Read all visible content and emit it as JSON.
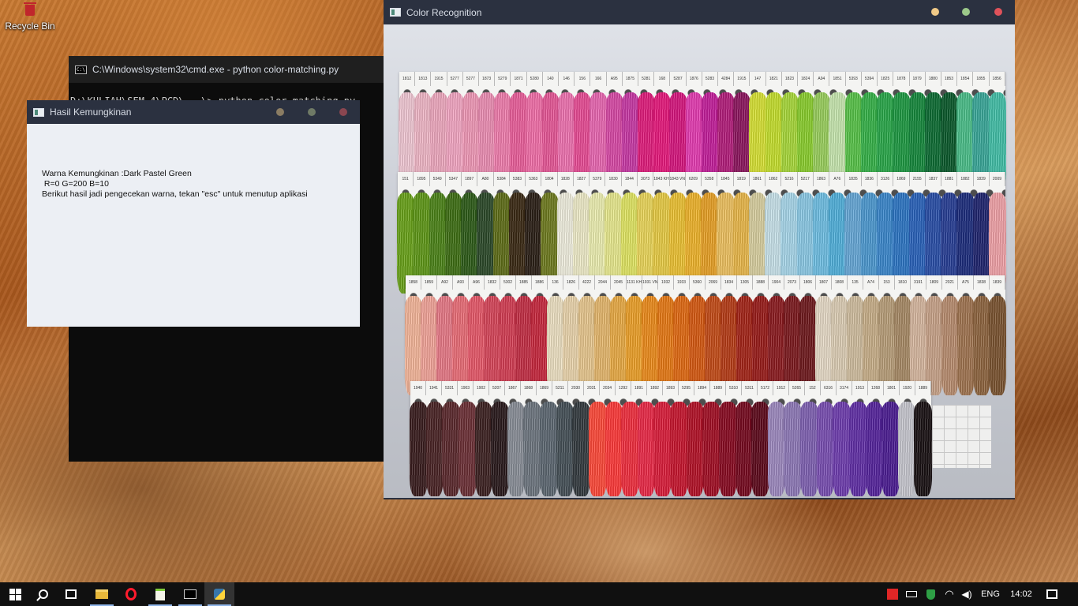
{
  "desktop": {
    "recycle_bin_label": "Recycle Bin"
  },
  "cmd_window": {
    "title": "C:\\Windows\\system32\\cmd.exe - python  color-matching.py",
    "console_line": "D:\\KULIAH\\SEM 4\\PCD\\...\\> python color-matching.py"
  },
  "hasil_window": {
    "title": "Hasil Kemungkinan",
    "line1": "Warna Kemungkinan :Dark Pastel Green",
    "line2": " R=0 G=200 B=10",
    "line3": "Berikut hasil jadi pengecekan warna, tekan \"esc\" untuk menutup aplikasi",
    "dot_colors": [
      "#8a7c63",
      "#6f7a66",
      "#8a4650"
    ]
  },
  "color_window": {
    "title": "Color Recognition",
    "dot_colors": [
      "#f0c987",
      "#9cc98a",
      "#e0525a"
    ],
    "rows": [
      {
        "labels": [
          "1812",
          "1813",
          "1915",
          "5277",
          "5277",
          "1873",
          "5279",
          "1871",
          "5280",
          "140",
          "146",
          "156",
          "166",
          "A95",
          "1875",
          "5281",
          "168",
          "5287",
          "1876",
          "5283",
          "4284",
          "1915",
          "147",
          "1821",
          "1823",
          "1824",
          "A94",
          "1851",
          "5393",
          "5394",
          "1825",
          "1878",
          "1879",
          "1880",
          "1853",
          "1854",
          "1855",
          "1856"
        ],
        "colors": [
          "#f3c9d6",
          "#f2b8c8",
          "#f0aac0",
          "#f5a7c4",
          "#f29ab8",
          "#ee8fb5",
          "#f17eae",
          "#ec5f9c",
          "#f46faa",
          "#e85898",
          "#f073b1",
          "#e94c96",
          "#ea68b3",
          "#d94aa7",
          "#c939a6",
          "#e21c7d",
          "#e8197d",
          "#d8167f",
          "#e63cb3",
          "#c51f9c",
          "#b41d7c",
          "#8d165f",
          "#d8e234",
          "#c6e02d",
          "#a8d93a",
          "#8bcf2e",
          "#9ad05d",
          "#c8e8b0",
          "#58c449",
          "#36b349",
          "#2aa84a",
          "#1f9a43",
          "#168a3d",
          "#0e6d34",
          "#0b5a2c",
          "#4bbf8a",
          "#3aa99a",
          "#43c0a8"
        ]
      },
      {
        "labels": [
          "151",
          "1895",
          "5349",
          "5347",
          "1897",
          "A80",
          "5384",
          "5383",
          "5363",
          "1804",
          "1828",
          "1827",
          "5379",
          "1830",
          "1844",
          "3073",
          "1843 KH",
          "1843 VNL",
          "6209",
          "5358",
          "1845",
          "1819",
          "1861",
          "1862",
          "5216",
          "5217",
          "1863",
          "A76",
          "1835",
          "1836",
          "3126",
          "1869",
          "2155",
          "1837",
          "1881",
          "1882",
          "1839",
          "2009"
        ],
        "colors": [
          "#6aa31a",
          "#5f9818",
          "#4c8419",
          "#3f7015",
          "#2e5c19",
          "#2c4a2a",
          "#5f6e18",
          "#3b2a14",
          "#2b2017",
          "#6f7c20",
          "#f2f0e0",
          "#f0edc9",
          "#eef0b2",
          "#e9eb8e",
          "#e2e763",
          "#ecd75a",
          "#e9cd45",
          "#eec333",
          "#f0b52b",
          "#e9a226",
          "#efc260",
          "#eab84a",
          "#d9d0a0",
          "#c9e4ec",
          "#a8d8ec",
          "#8ccbe7",
          "#6fc0e5",
          "#52b2dd",
          "#66a8d8",
          "#4d9ad2",
          "#3b88cd",
          "#2d76c5",
          "#2a63bc",
          "#2a4fa8",
          "#283f96",
          "#1e2e7e",
          "#202570",
          "#f2a3a8"
        ]
      },
      {
        "labels": [
          "1858",
          "1859",
          "A92",
          "A93",
          "A96",
          "1832",
          "5302",
          "1885",
          "1886",
          "136",
          "1826",
          "4222",
          "2044",
          "2045",
          "1131 KH",
          "1931 VNL",
          "1932",
          "1933",
          "5360",
          "2069",
          "1834",
          "1305",
          "1888",
          "1904",
          "2073",
          "1806",
          "1807",
          "1808",
          "135",
          "A74",
          "153",
          "1810",
          "3191",
          "1809",
          "2021",
          "A75",
          "1838",
          "1839"
        ],
        "colors": [
          "#f6b79b",
          "#f4a59a",
          "#e87a87",
          "#ec6e78",
          "#e8596a",
          "#d8465a",
          "#d53e54",
          "#c52f45",
          "#c8283e",
          "#efe2c4",
          "#ecd6ad",
          "#e9c88f",
          "#e7b86d",
          "#ebac45",
          "#eea129",
          "#ee8c1b",
          "#e87a15",
          "#e26a12",
          "#d75a12",
          "#c54c18",
          "#b73c17",
          "#a52418",
          "#9a1c1a",
          "#8c1b20",
          "#7d1a1f",
          "#701a1e",
          "#e8dcc8",
          "#decfb6",
          "#d2bfa0",
          "#c9b08a",
          "#b99f7a",
          "#a98b66",
          "#d8b8a0",
          "#c9a48a",
          "#b98d6f",
          "#a17551",
          "#8f6540",
          "#7b5431"
        ]
      },
      {
        "labels": [
          "1940",
          "1941",
          "5331",
          "1903",
          "1902",
          "5207",
          "1867",
          "1868",
          "1869",
          "5211",
          "2030",
          "2031",
          "2034",
          "1292",
          "1891",
          "1892",
          "1893",
          "5295",
          "1894",
          "1889",
          "5310",
          "5311",
          "5172",
          "1912",
          "5265",
          "152",
          "6316",
          "3174",
          "1913",
          "1268",
          "1801",
          "1920",
          "1889"
        ],
        "colors": [
          "#3a1d1f",
          "#4b2426",
          "#5c2a2e",
          "#6d3137",
          "#3d2222",
          "#2a1a1c",
          "#8a8f98",
          "#6e7680",
          "#5d6872",
          "#465158",
          "#343b40",
          "#ff4a3a",
          "#ff3a3a",
          "#f22f3f",
          "#ec2a48",
          "#dc1d3b",
          "#c8162f",
          "#b51228",
          "#a30f25",
          "#8a0b22",
          "#770a20",
          "#5e0a1c",
          "#9e8ac0",
          "#8f7ab8",
          "#8062b3",
          "#7a4fb3",
          "#6f3eb0",
          "#6230a7",
          "#57259e",
          "#4c1d94",
          "#c8c8d0",
          "#1a1214"
        ]
      }
    ]
  },
  "taskbar": {
    "apps": [
      {
        "name": "start",
        "icon": "windows-icon"
      },
      {
        "name": "search",
        "icon": "search-icon"
      },
      {
        "name": "task-view",
        "icon": "task-view-icon"
      },
      {
        "name": "file-explorer",
        "icon": "folder-icon"
      },
      {
        "name": "opera",
        "icon": "opera-icon"
      },
      {
        "name": "notepad",
        "icon": "notepad-icon"
      },
      {
        "name": "cmd",
        "icon": "cmd-icon"
      },
      {
        "name": "python",
        "icon": "python-icon"
      }
    ],
    "language": "ENG",
    "time": "14:02",
    "accent": "#8fb5e8"
  }
}
